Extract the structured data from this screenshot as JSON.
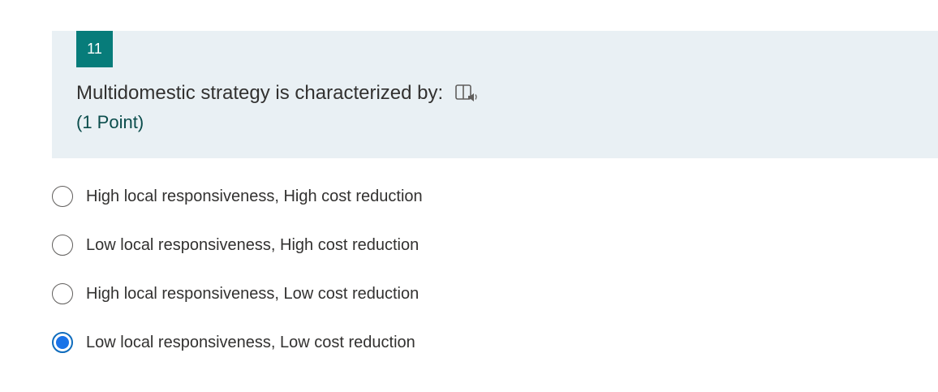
{
  "question": {
    "number": "11",
    "title": "Multidomestic strategy is characterized by:",
    "points": "(1 Point)",
    "reader_icon": "immersive-reader-icon",
    "colors": {
      "number_badge": "#077c7a",
      "card_background": "#e9f0f4",
      "points_text": "#0b4d4c",
      "selected_radio": "#1a73e8"
    }
  },
  "options": [
    {
      "label": "High local responsiveness, High cost reduction",
      "selected": false
    },
    {
      "label": "Low local responsiveness, High cost reduction",
      "selected": false
    },
    {
      "label": "High local responsiveness, Low cost reduction",
      "selected": false
    },
    {
      "label": "Low local responsiveness, Low cost reduction",
      "selected": true
    }
  ]
}
